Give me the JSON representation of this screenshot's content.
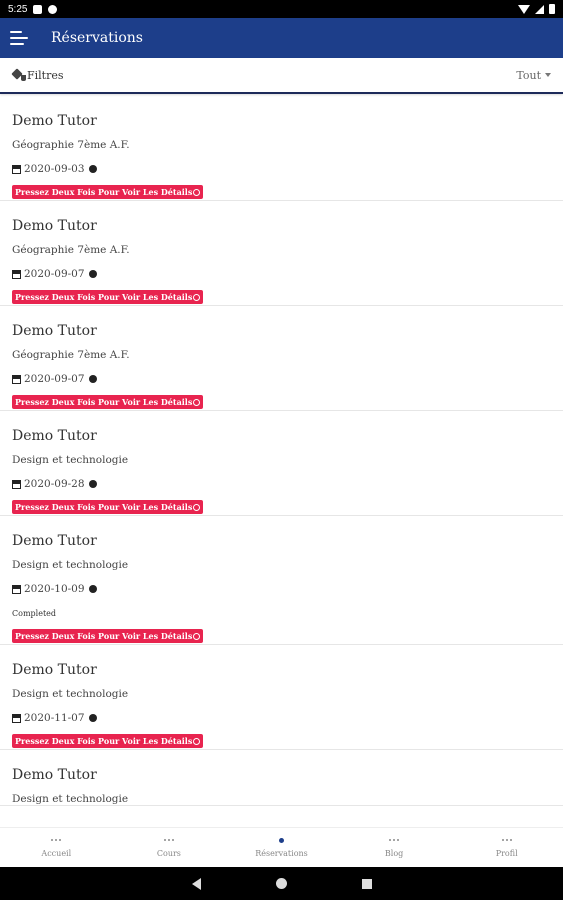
{
  "status_bar": {
    "time": "5:25"
  },
  "app_bar": {
    "title": "Réservations",
    "menu_icon": "menu-icon"
  },
  "filter_bar": {
    "filter_label": "Filtres",
    "filter_icon": "tag-icon",
    "select_value": "Tout"
  },
  "colors": {
    "primary": "#1d3e8a",
    "badge": "#e8244f",
    "divider": "#1d2a5a"
  },
  "reservations": [
    {
      "tutor": "Demo Tutor",
      "subject": "Géographie 7ème A.F.",
      "date": "2020-09-03",
      "status": "",
      "action_label": "Pressez Deux Fois Pour Voir Les Détails"
    },
    {
      "tutor": "Demo Tutor",
      "subject": "Géographie 7ème A.F.",
      "date": "2020-09-07",
      "status": "",
      "action_label": "Pressez Deux Fois Pour Voir Les Détails"
    },
    {
      "tutor": "Demo Tutor",
      "subject": "Géographie 7ème A.F.",
      "date": "2020-09-07",
      "status": "",
      "action_label": "Pressez Deux Fois Pour Voir Les Détails"
    },
    {
      "tutor": "Demo Tutor",
      "subject": "Design et technologie",
      "date": "2020-09-28",
      "status": "",
      "action_label": "Pressez Deux Fois Pour Voir Les Détails"
    },
    {
      "tutor": "Demo Tutor",
      "subject": "Design et technologie",
      "date": "2020-10-09",
      "status": "Completed",
      "action_label": "Pressez Deux Fois Pour Voir Les Détails"
    },
    {
      "tutor": "Demo Tutor",
      "subject": "Design et technologie",
      "date": "2020-11-07",
      "status": "",
      "action_label": "Pressez Deux Fois Pour Voir Les Détails"
    },
    {
      "tutor": "Demo Tutor",
      "subject": "Design et technologie",
      "date": "",
      "status": "",
      "action_label": ""
    }
  ],
  "bottom_nav": [
    {
      "label": "Accueil",
      "active": false
    },
    {
      "label": "Cours",
      "active": false
    },
    {
      "label": "Réservations",
      "active": true
    },
    {
      "label": "Blog",
      "active": false
    },
    {
      "label": "Profil",
      "active": false
    }
  ]
}
